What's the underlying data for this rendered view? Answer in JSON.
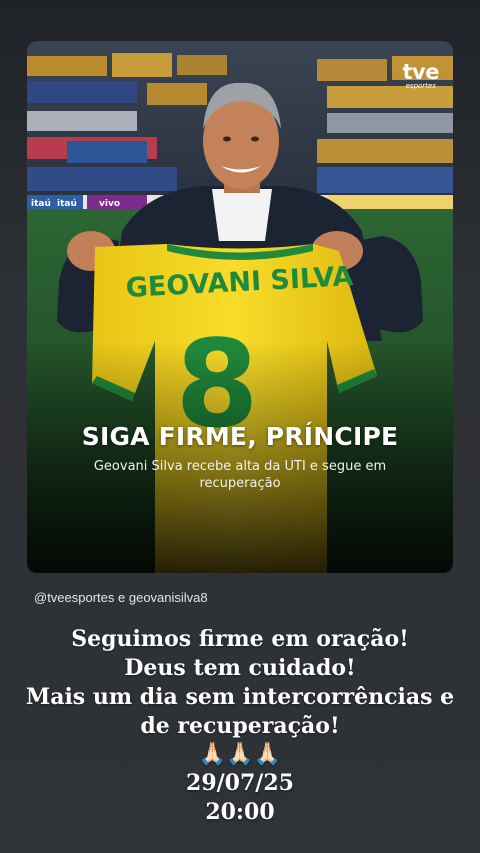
{
  "post": {
    "brand": {
      "logo_word": "tve",
      "logo_sub": "esportes"
    },
    "jersey_name": "GEOVANI SILVA",
    "jersey_number": "8",
    "ad_boards": [
      "itaú",
      "itaú",
      "vivo"
    ],
    "headline": "SIGA FIRME, PRÍNCIPE",
    "subheadline": "Geovani Silva recebe alta da UTI e segue em recuperação"
  },
  "mention": "@tveesportes e geovanisilva8",
  "caption": {
    "line1": "Seguimos firme em oração!",
    "line2": "Deus tem cuidado!",
    "line3": "Mais um dia sem intercorrências e",
    "line4": "de recuperação!",
    "emoji": "🙏🏻🙏🏻🙏🏻",
    "date": "29/07/25",
    "time": "20:00"
  },
  "colors": {
    "jersey_yellow": "#f4d21f",
    "jersey_green": "#1f8a3b",
    "pitch_green": "#24502a"
  }
}
